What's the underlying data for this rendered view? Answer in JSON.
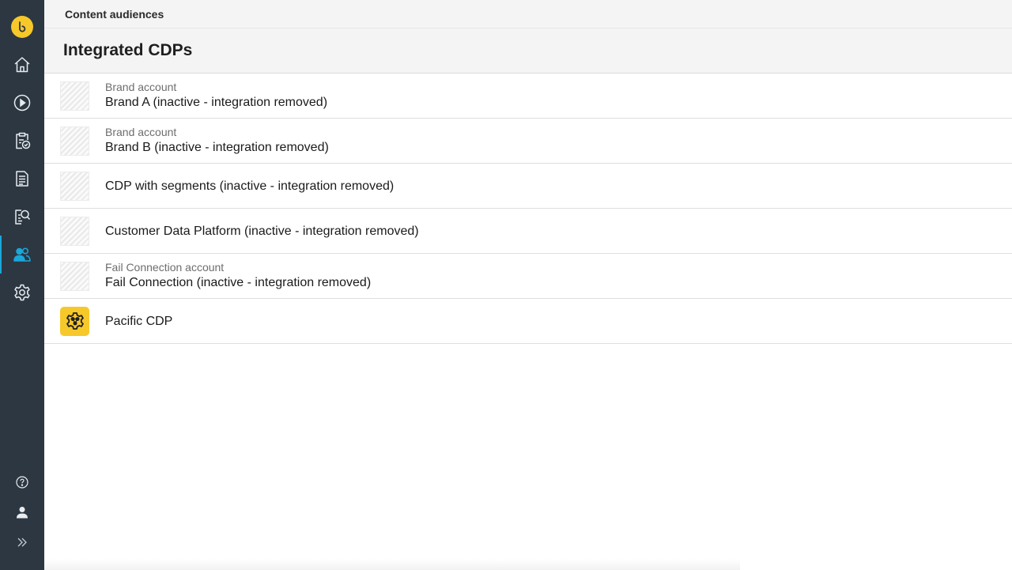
{
  "app": {
    "logo_icon": "brand-logo-icon",
    "accent_color": "#1aa7d9",
    "brand_color": "#f7c82a"
  },
  "sidebar": {
    "items": [
      {
        "name": "home",
        "icon": "home-icon"
      },
      {
        "name": "play",
        "icon": "play-circle-icon"
      },
      {
        "name": "clipboard-check",
        "icon": "clipboard-check-icon"
      },
      {
        "name": "document",
        "icon": "document-icon"
      },
      {
        "name": "search-document",
        "icon": "document-search-icon"
      },
      {
        "name": "audiences",
        "icon": "users-icon",
        "active": true
      },
      {
        "name": "settings",
        "icon": "gear-icon"
      }
    ],
    "bottom": [
      {
        "name": "help",
        "icon": "help-circle-icon"
      },
      {
        "name": "profile",
        "icon": "user-icon"
      },
      {
        "name": "expand",
        "icon": "double-chevron-right-icon"
      }
    ]
  },
  "header": {
    "breadcrumb": "Content audiences"
  },
  "page": {
    "title": "Integrated CDPs"
  },
  "cdps": [
    {
      "subtitle": "Brand account",
      "title": "Brand A (inactive - integration removed)",
      "icon": "placeholder-thumb"
    },
    {
      "subtitle": "Brand account",
      "title": "Brand B (inactive - integration removed)",
      "icon": "placeholder-thumb"
    },
    {
      "subtitle": "",
      "title": "CDP with segments (inactive - integration removed)",
      "icon": "placeholder-thumb"
    },
    {
      "subtitle": "",
      "title": "Customer Data Platform (inactive - integration removed)",
      "icon": "placeholder-thumb"
    },
    {
      "subtitle": "Fail Connection account",
      "title": "Fail Connection (inactive - integration removed)",
      "icon": "placeholder-thumb"
    },
    {
      "subtitle": "",
      "title": "Pacific CDP",
      "icon": "gear-network-icon"
    }
  ]
}
